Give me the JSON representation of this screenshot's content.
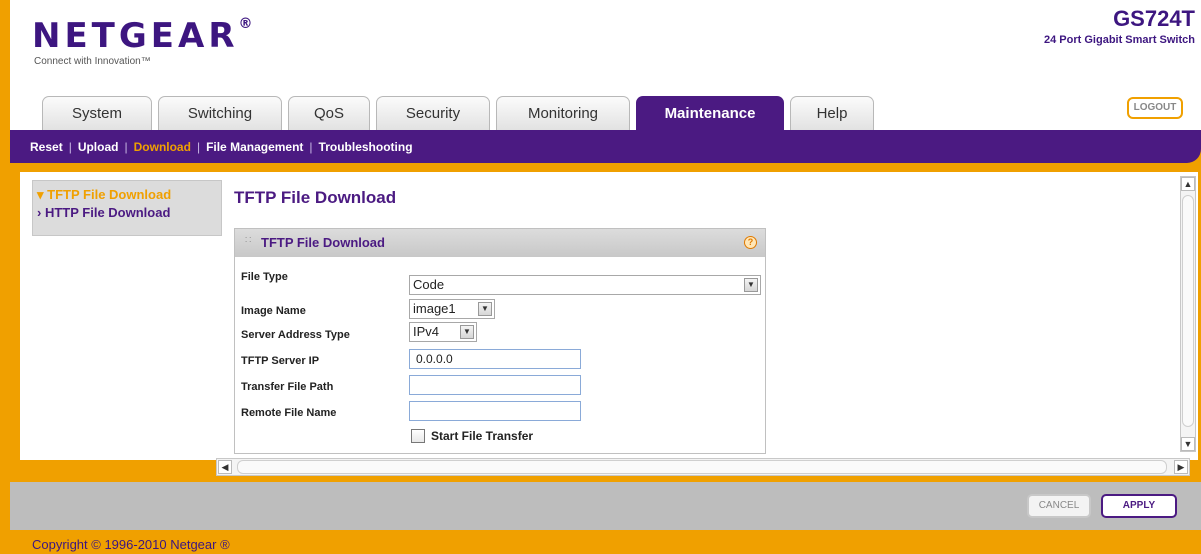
{
  "brand": {
    "logo": "NETGEAR",
    "logo_mark": "®",
    "tagline": "Connect with Innovation™"
  },
  "product": {
    "model": "GS724T",
    "description": "24 Port Gigabit Smart Switch"
  },
  "tabs": [
    {
      "label": "System"
    },
    {
      "label": "Switching"
    },
    {
      "label": "QoS"
    },
    {
      "label": "Security"
    },
    {
      "label": "Monitoring"
    },
    {
      "label": "Maintenance",
      "active": true
    },
    {
      "label": "Help"
    }
  ],
  "logout_label": "LOGOUT",
  "subnav": {
    "items": [
      "Reset",
      "Upload",
      "Download",
      "File Management",
      "Troubleshooting"
    ],
    "current": "Download",
    "separator": "|"
  },
  "sidebar": {
    "items": [
      {
        "label": "TFTP File Download",
        "marker": "▾",
        "active": true
      },
      {
        "label": "HTTP File Download",
        "marker": "›",
        "active": false
      }
    ]
  },
  "page_title": "TFTP File Download",
  "panel": {
    "title": "TFTP File Download",
    "help_glyph": "?",
    "fields": {
      "file_type": {
        "label": "File Type",
        "value": "Code"
      },
      "image_name": {
        "label": "Image Name",
        "value": "image1"
      },
      "server_address_type": {
        "label": "Server Address Type",
        "value": "IPv4"
      },
      "tftp_server_ip": {
        "label": "TFTP Server IP",
        "value": "0.0.0.0"
      },
      "transfer_file_path": {
        "label": "Transfer File Path",
        "value": ""
      },
      "remote_file_name": {
        "label": "Remote File Name",
        "value": ""
      },
      "start_transfer": {
        "label": "Start File Transfer",
        "checked": false
      }
    }
  },
  "buttons": {
    "cancel": "CANCEL",
    "apply": "APPLY"
  },
  "copyright": "Copyright © 1996-2010 Netgear ®",
  "colors": {
    "brand_purple": "#4b1a82",
    "accent_orange": "#f0a000"
  }
}
